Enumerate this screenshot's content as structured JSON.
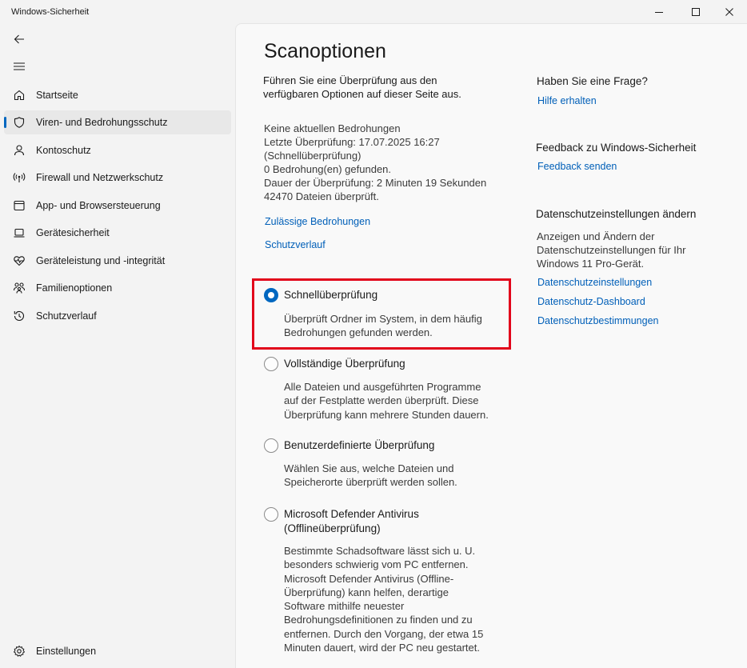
{
  "window": {
    "title": "Windows-Sicherheit"
  },
  "sidebar": {
    "items": [
      {
        "label": "Startseite",
        "icon": "home-icon"
      },
      {
        "label": "Viren- und Bedrohungsschutz",
        "icon": "shield-icon",
        "active": true
      },
      {
        "label": "Kontoschutz",
        "icon": "person-icon"
      },
      {
        "label": "Firewall und Netzwerkschutz",
        "icon": "antenna-icon"
      },
      {
        "label": "App- und Browsersteuerung",
        "icon": "app-window-icon"
      },
      {
        "label": "Gerätesicherheit",
        "icon": "laptop-icon"
      },
      {
        "label": "Geräteleistung und -integrität",
        "icon": "heart-pulse-icon"
      },
      {
        "label": "Familienoptionen",
        "icon": "family-icon"
      },
      {
        "label": "Schutzverlauf",
        "icon": "history-icon"
      }
    ],
    "settings_label": "Einstellungen"
  },
  "main": {
    "title": "Scanoptionen",
    "intro": [
      "Führen Sie eine Überprüfung aus den",
      "verfügbaren Optionen auf dieser Seite aus."
    ],
    "status": [
      "Keine aktuellen Bedrohungen",
      "Letzte Überprüfung: 17.07.2025 16:27",
      "(Schnellüberprüfung)",
      "0 Bedrohung(en) gefunden.",
      "Dauer der Überprüfung: 2 Minuten 19 Sekunden",
      "42470 Dateien überprüft."
    ],
    "links": {
      "allowed_threats": "Zulässige Bedrohungen",
      "protection_history": "Schutzverlauf"
    },
    "scan_options": [
      {
        "label": [
          "Schnellüberprüfung"
        ],
        "description": [
          "Überprüft Ordner im System, in dem häufig",
          "Bedrohungen gefunden werden."
        ],
        "selected": true
      },
      {
        "label": [
          "Vollständige Überprüfung"
        ],
        "description": [
          "Alle Dateien und ausgeführten Programme",
          "auf der Festplatte werden überprüft. Diese",
          "Überprüfung kann mehrere Stunden dauern."
        ],
        "selected": false
      },
      {
        "label": [
          "Benutzerdefinierte Überprüfung"
        ],
        "description": [
          "Wählen Sie aus, welche Dateien und",
          "Speicherorte überprüft werden sollen."
        ],
        "selected": false
      },
      {
        "label": [
          "Microsoft Defender Antivirus",
          "(Offlineüberprüfung)"
        ],
        "description": [
          "Bestimmte Schadsoftware lässt sich u. U.",
          "besonders schwierig vom PC entfernen.",
          "Microsoft Defender Antivirus (Offline-",
          "Überprüfung) kann helfen, derartige",
          "Software mithilfe neuester",
          "Bedrohungsdefinitionen zu finden und zu",
          "entfernen. Durch den Vorgang, der etwa 15",
          "Minuten dauert, wird der PC neu gestartet."
        ],
        "selected": false
      }
    ]
  },
  "aside": {
    "question": {
      "heading": "Haben Sie eine Frage?",
      "link": "Hilfe erhalten"
    },
    "feedback": {
      "heading": "Feedback zu Windows-Sicherheit",
      "link": "Feedback senden"
    },
    "privacy": {
      "heading": "Datenschutzeinstellungen ändern",
      "text": [
        "Anzeigen und Ändern der",
        "Datenschutzeinstellungen für Ihr",
        "Windows 11 Pro-Gerät."
      ],
      "links": [
        "Datenschutzeinstellungen",
        "Datenschutz-Dashboard",
        "Datenschutzbestimmungen"
      ]
    }
  },
  "colors": {
    "accent": "#0067c0",
    "link": "#005fb8",
    "highlight_border": "#e2051b"
  }
}
